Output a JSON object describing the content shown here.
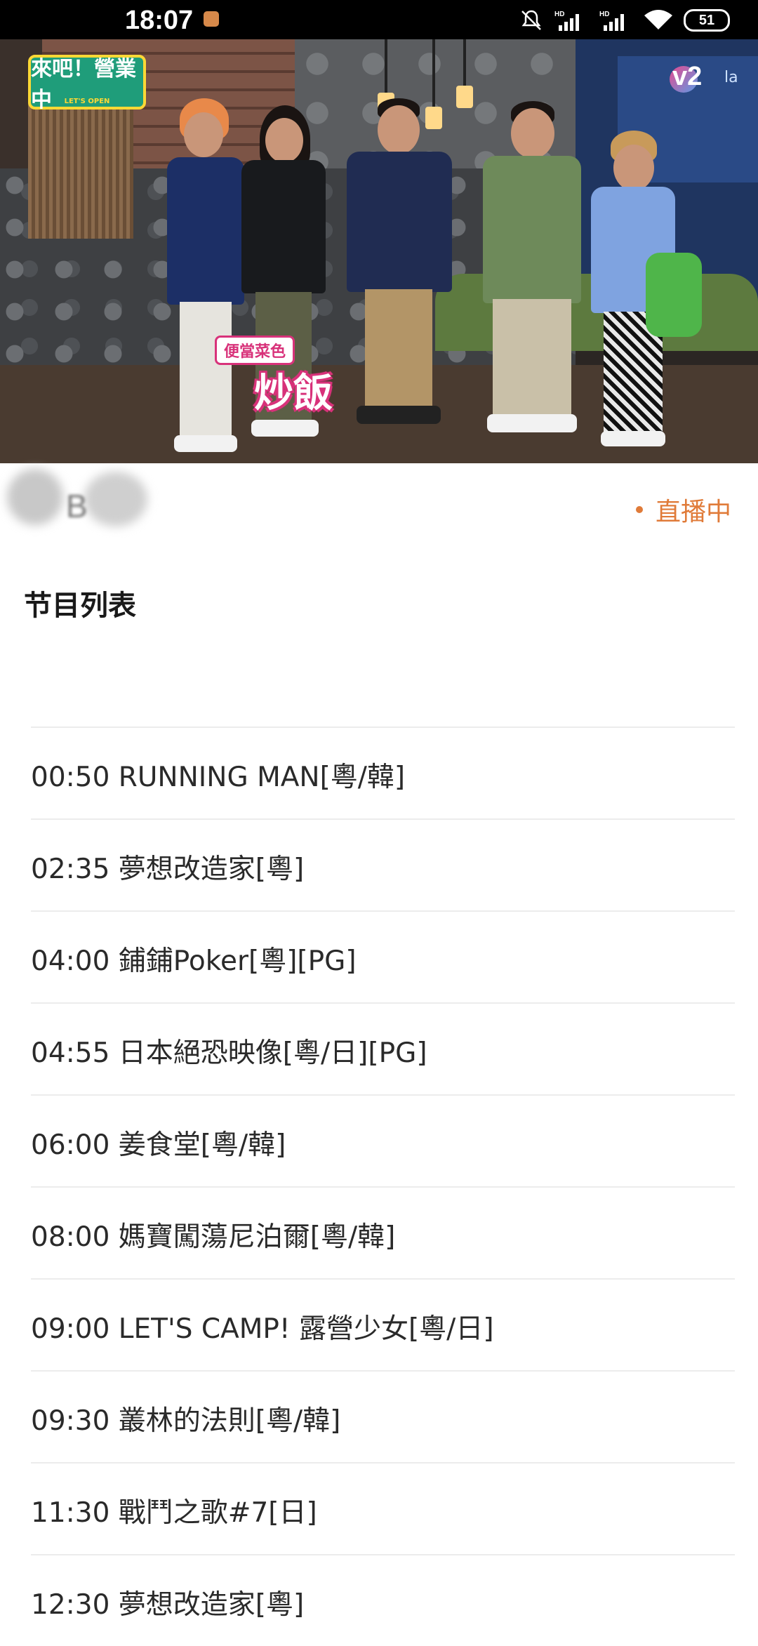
{
  "status_bar": {
    "time": "18:07",
    "battery": "51",
    "icons": [
      "mute-icon",
      "signal-hd-icon",
      "signal-hd-icon",
      "wifi-icon",
      "battery-icon"
    ]
  },
  "video": {
    "show_logo": "來吧！營業中",
    "show_logo_sub": "LET'S OPEN",
    "channel_logo": "v2",
    "channel_logo_extra": "la",
    "caption_tag": "便當菜色",
    "caption_main": "炒飯"
  },
  "channel": {
    "name": "B",
    "live_label": "直播中"
  },
  "schedule": {
    "title": "节目列表",
    "items": [
      "00:50 RUNNING MAN[粵/韓]",
      "02:35 夢想改造家[粵]",
      "04:00 鋪鋪Poker[粵][PG]",
      "04:55 日本絕恐映像[粵/日][PG]",
      "06:00 姜食堂[粵/韓]",
      "08:00 媽寶闖蕩尼泊爾[粵/韓]",
      "09:00 LET'S CAMP! 露營少女[粵/日]",
      "09:30 叢林的法則[粵/韓]",
      "11:30 戰鬥之歌#7[日]",
      "12:30 夢想改造家[粵]"
    ]
  },
  "colors": {
    "accent": "#e07b39",
    "divider": "#ececec",
    "text": "#2a2a2a"
  }
}
